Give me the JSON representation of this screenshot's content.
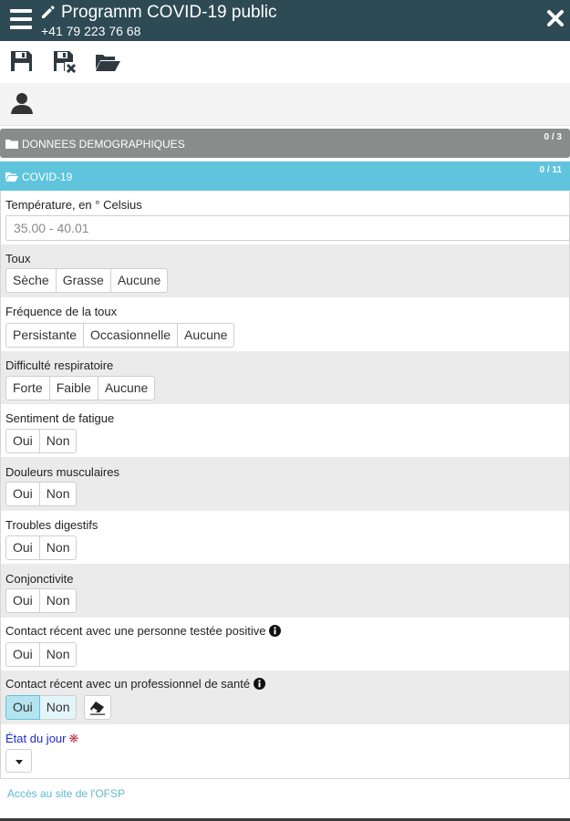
{
  "header": {
    "title": "Programm COVID-19 public",
    "phone": "+41 79 223 76 68",
    "icons": {
      "menu": "hamburger-menu-icon",
      "edit": "pencil-icon",
      "close": "close-icon"
    }
  },
  "toolbar": {
    "icons": [
      "save-icon",
      "save-discard-icon",
      "open-folder-icon"
    ]
  },
  "userbar": {
    "icon": "user-icon"
  },
  "sections": [
    {
      "label": "DONNEES DEMOGRAPHIQUES",
      "count": "0 / 3",
      "icon": "folder-closed-icon",
      "color": "#8a8c8c"
    },
    {
      "label": "COVID-19",
      "count": "0 / 11",
      "icon": "folder-open-icon",
      "color": "#5fc4dc"
    }
  ],
  "form": {
    "temperature": {
      "label": "Température, en ° Celsius",
      "placeholder": "35.00 - 40.01",
      "value": ""
    },
    "toux": {
      "label": "Toux",
      "options": [
        "Sèche",
        "Grasse",
        "Aucune"
      ]
    },
    "frequence": {
      "label": "Fréquence de la toux",
      "options": [
        "Persistante",
        "Occasionnelle",
        "Aucune"
      ]
    },
    "difficulte": {
      "label": "Difficulté respiratoire",
      "options": [
        "Forte",
        "Faible",
        "Aucune"
      ]
    },
    "fatigue": {
      "label": "Sentiment de fatigue",
      "options": [
        "Oui",
        "Non"
      ]
    },
    "douleurs": {
      "label": "Douleurs musculaires",
      "options": [
        "Oui",
        "Non"
      ]
    },
    "digestifs": {
      "label": "Troubles digestifs",
      "options": [
        "Oui",
        "Non"
      ]
    },
    "conjonctivite": {
      "label": "Conjonctivite",
      "options": [
        "Oui",
        "Non"
      ]
    },
    "contact_positive": {
      "label": "Contact récent avec une personne testée positive",
      "options": [
        "Oui",
        "Non"
      ],
      "info_icon": "info-icon"
    },
    "contact_sante": {
      "label": "Contact récent avec un professionnel de santé",
      "options": [
        "Oui",
        "Non"
      ],
      "selected": "Oui",
      "info_icon": "info-icon",
      "clear_icon": "eraser-icon"
    },
    "etat": {
      "label": "État du jour",
      "required_mark": "❋",
      "dropdown_icon": "caret-down-icon"
    }
  },
  "footer": {
    "link": "Accès au site de l'OFSP"
  },
  "colors": {
    "header_bg": "#2e4a54",
    "accent": "#5fc4dc",
    "section_gray": "#8a8c8c",
    "selected_bg": "#b5e3ef",
    "required": "#c8334a",
    "etat_label": "#1f2bd0"
  }
}
